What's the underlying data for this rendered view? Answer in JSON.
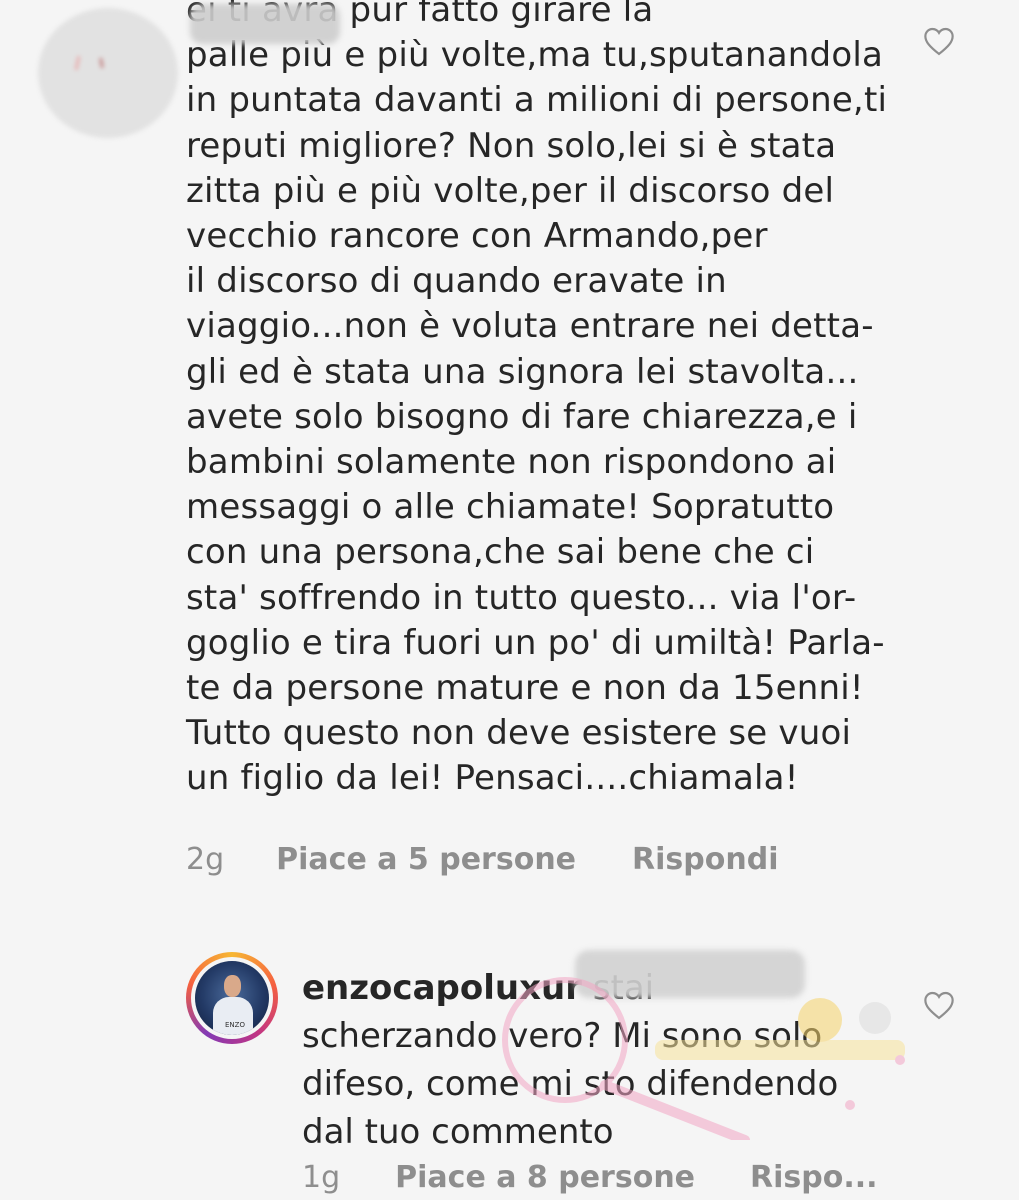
{
  "comment": {
    "text": "  ei ti avrà pur fatto girare la\npalle più e più volte,ma tu,sputanandola\nin puntata davanti a milioni di persone,ti\nreputi migliore? Non solo,lei si è stata\nzitta più e più volte,per il discorso del\nvecchio rancore con Armando,per\nil discorso di quando eravate in\nviaggio...non è voluta entrare nei detta-\ngli ed è stata una signora lei stavolta...\navete solo bisogno di fare chiarezza,e i\nbambini solamente non rispondono ai\nmessaggi o alle chiamate! Sopratutto\ncon una persona,che sai bene che ci\nsta' soffrendo in tutto questo... via l'or-\ngoglio e tira fuori un po' di umiltà! Parla-\nte da persone mature e non da 15enni!\nTutto questo non deve esistere se vuoi\nun figlio da lei! Pensaci....chiamala!",
    "time": "2g",
    "likes": "Piace a 5 persone",
    "reply": "Rispondi",
    "like_icon": "heart-outline-icon"
  },
  "reply_comment": {
    "username": "enzocapoluxur",
    "avatar_caption": "ENZO",
    "text_after_username": "stai\nscherzando vero? Mi sono solo\ndifeso, come mi sto difendendo\ndal tuo commento",
    "time": "1g",
    "likes": "Piace a 8 persone",
    "reply": "Rispo...",
    "like_icon": "heart-outline-icon"
  },
  "colors": {
    "background": "#f5f5f5",
    "text": "#262626",
    "meta": "#8e8e8e"
  }
}
